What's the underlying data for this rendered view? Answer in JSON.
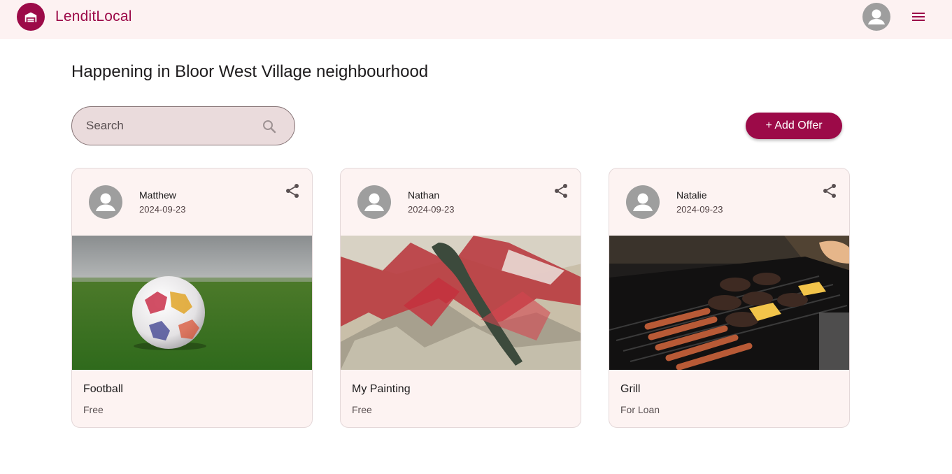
{
  "app": {
    "name": "LenditLocal"
  },
  "page": {
    "title": "Happening in Bloor West Village neighbourhood"
  },
  "search": {
    "placeholder": "Search"
  },
  "actions": {
    "add_offer_label": "+ Add Offer"
  },
  "colors": {
    "brand": "#9c0a48",
    "topbar_bg": "#fdf2f2",
    "card_bg": "#fdf3f2",
    "search_bg": "#eadbdc"
  },
  "icons": {
    "logo": "home-storage-icon",
    "user": "account-circle-icon",
    "menu": "hamburger-menu-icon",
    "search": "search-icon",
    "share": "share-icon"
  },
  "cards": [
    {
      "author": "Matthew",
      "date": "2024-09-23",
      "title": "Football",
      "status": "Free",
      "image": "soccer ball on grass"
    },
    {
      "author": "Nathan",
      "date": "2024-09-23",
      "title": "My Painting",
      "status": "Free",
      "image": "abstract red painting"
    },
    {
      "author": "Natalie",
      "date": "2024-09-23",
      "title": "Grill",
      "status": "For Loan",
      "image": "barbecue grill with food"
    }
  ]
}
